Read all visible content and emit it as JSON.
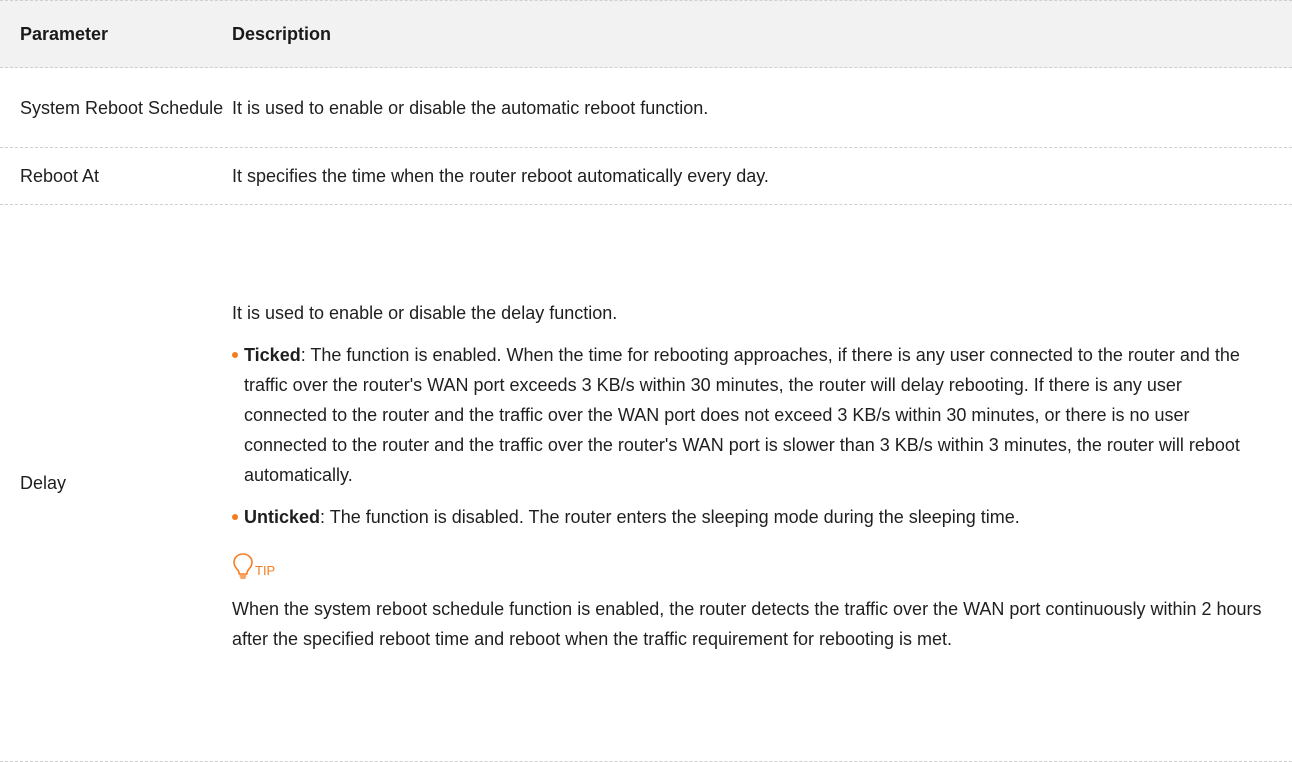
{
  "table": {
    "header": {
      "parameter": "Parameter",
      "description": "Description"
    },
    "rows": [
      {
        "parameter": "System Reboot Schedule",
        "description": "It is used to enable or disable the automatic reboot function."
      },
      {
        "parameter": "Reboot At",
        "description": "It specifies the time when the router reboot automatically every day."
      },
      {
        "parameter": "Delay",
        "intro": "It is used to enable or disable the delay function.",
        "bullets": [
          {
            "term": "Ticked",
            "text": ": The function is enabled. When the time for rebooting approaches, if there is any user connected to the router and the traffic over the router's WAN port exceeds 3 KB/s within 30 minutes, the router will delay rebooting. If there is any user connected to the router and the traffic over the WAN port does not exceed 3 KB/s within 30 minutes, or there is no user connected to the router and the traffic over the router's WAN port is slower than 3 KB/s within 3 minutes, the router will reboot automatically."
          },
          {
            "term": "Unticked",
            "text": ": The function is disabled. The router enters the sleeping mode during the sleeping time."
          }
        ],
        "tip": {
          "icon": "lightbulb-icon",
          "label": "TIP",
          "text": "When the system reboot schedule function is enabled, the router detects the traffic over the WAN port continuously within 2 hours after the specified reboot time and reboot when the traffic requirement for rebooting is met."
        }
      }
    ]
  },
  "colors": {
    "accent": "#f47c20",
    "header_bg": "#f2f2f2",
    "divider": "#cfcfcf"
  }
}
